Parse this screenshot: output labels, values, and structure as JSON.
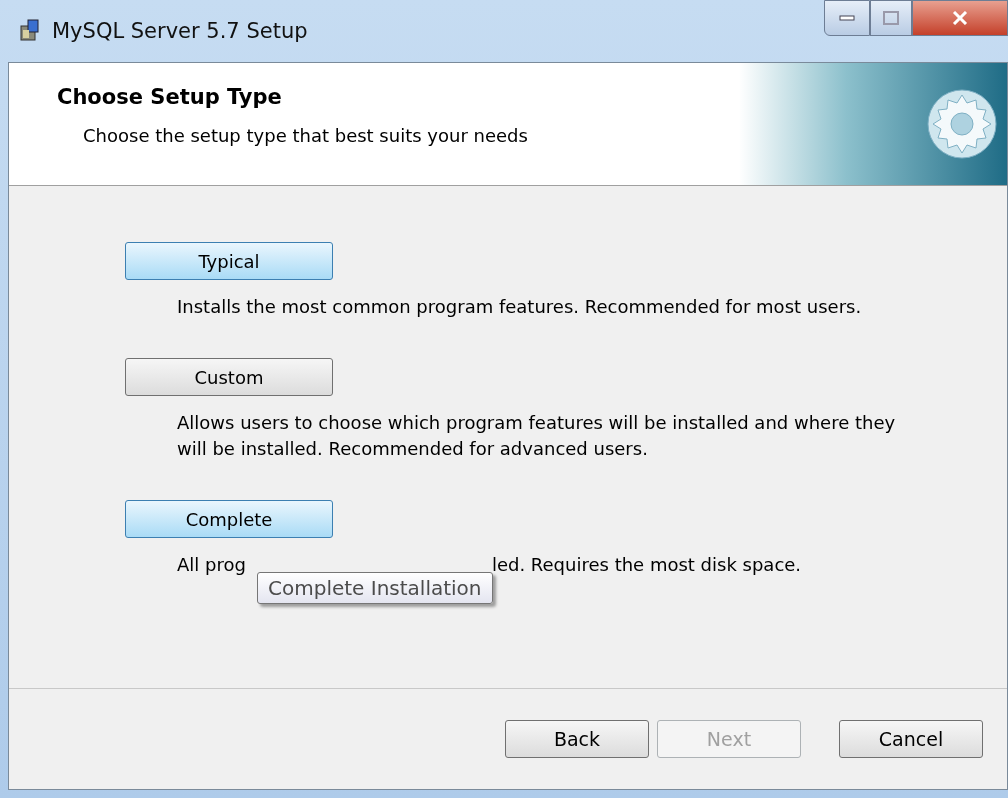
{
  "window": {
    "title": "MySQL Server 5.7 Setup"
  },
  "header": {
    "title": "Choose Setup Type",
    "subtitle": "Choose the setup type that best suits your needs"
  },
  "options": [
    {
      "label": "Typical",
      "highlighted": true,
      "description": [
        "Installs the most common program features. Recommended for most users."
      ]
    },
    {
      "label": "Custom",
      "highlighted": false,
      "description": [
        "Allows users to choose which program features will be installed and where they will be installed. Recommended for advanced users."
      ]
    },
    {
      "label": "Complete",
      "highlighted": true,
      "description": [
        "All prog",
        "led. Requires the most disk space."
      ]
    }
  ],
  "tooltip": "Complete Installation",
  "buttons": [
    {
      "label": "Back",
      "disabled": false
    },
    {
      "label": "Next",
      "disabled": true
    },
    {
      "label": "Cancel",
      "disabled": false
    }
  ]
}
